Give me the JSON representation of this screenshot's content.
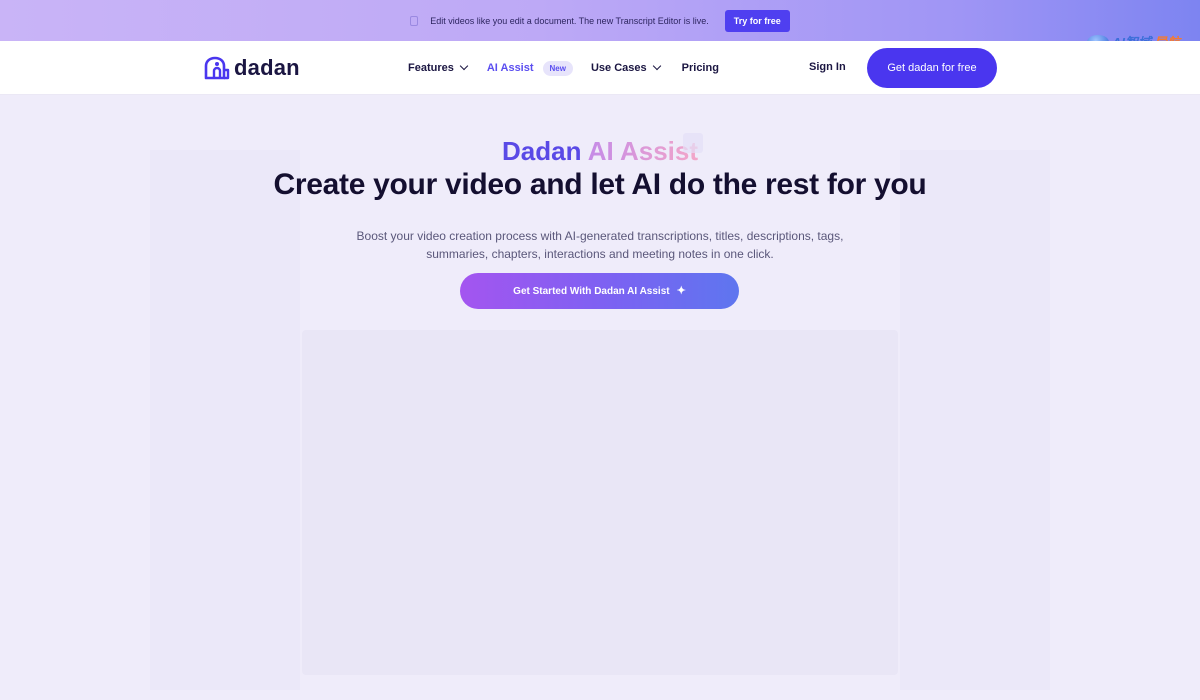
{
  "banner": {
    "text": "Edit videos like you edit a document. The new Transcript Editor is live.",
    "button_label": "Try for free"
  },
  "watermark": {
    "text_main": "AI智域",
    "text_accent": "导航"
  },
  "nav": {
    "logo_text": "dadan",
    "items": [
      {
        "label": "Features"
      },
      {
        "label": "AI Assist",
        "badge": "New"
      },
      {
        "label": "Use Cases"
      },
      {
        "label": "Pricing"
      }
    ],
    "signin_label": "Sign In",
    "cta_label": "Get dadan for free"
  },
  "hero": {
    "eyebrow_brand": "Dadan",
    "eyebrow_product": "AI Assist",
    "title": "Create your video and let AI do the rest for you",
    "subtitle": "Boost your video creation process with AI-generated transcriptions, titles, descriptions, tags, summaries, chapters, interactions and meeting notes in one click.",
    "cta_label": "Get Started With Dadan AI Assist"
  },
  "colors": {
    "brand": "#4a36ef",
    "accent": "#5b4ef0",
    "background": "#efecfa"
  }
}
